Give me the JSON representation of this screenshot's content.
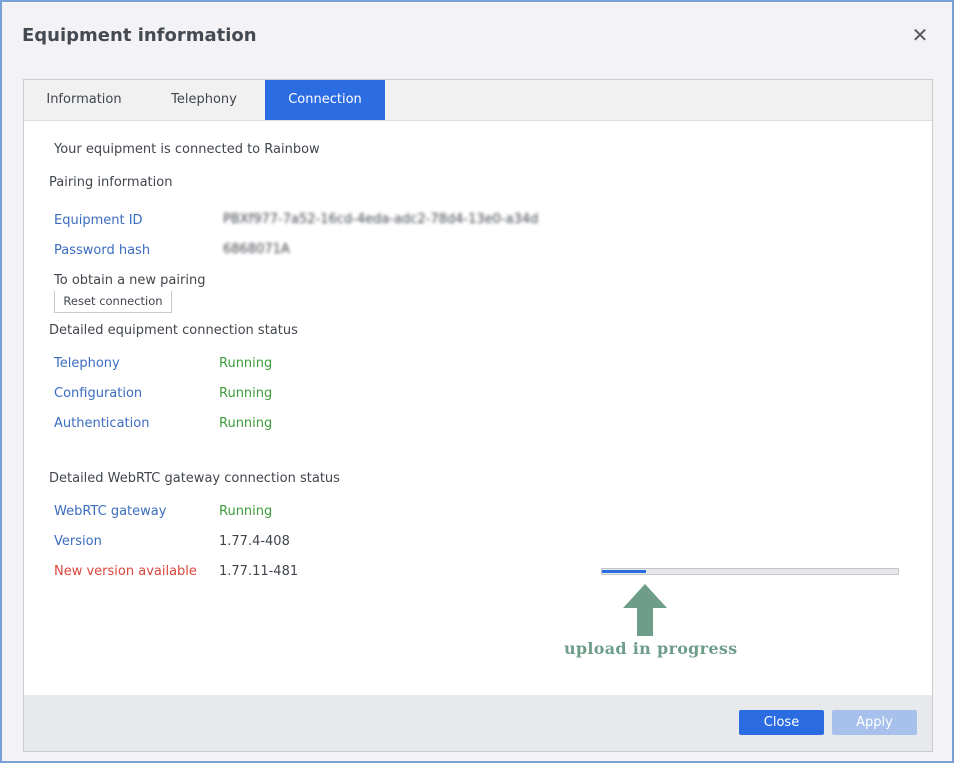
{
  "dialog": {
    "title": "Equipment information",
    "close_icon": "close-icon"
  },
  "tabs": [
    {
      "label": "Information",
      "active": false
    },
    {
      "label": "Telephony",
      "active": false
    },
    {
      "label": "Connection",
      "active": true
    }
  ],
  "connection": {
    "connected_message": "Your equipment is connected to Rainbow",
    "pairing_heading": "Pairing information",
    "equipment_id_label": "Equipment ID",
    "equipment_id_value": "PBXf977-7a52-16cd-4eda-adc2-78d4-13e0-a34d",
    "password_hash_label": "Password hash",
    "password_hash_value": "6868071A",
    "new_pairing_text": "To obtain a new pairing",
    "reset_button": "Reset connection",
    "equipment_status_heading": "Detailed equipment connection status",
    "equipment_status": [
      {
        "label": "Telephony",
        "value": "Running"
      },
      {
        "label": "Configuration",
        "value": "Running"
      },
      {
        "label": "Authentication",
        "value": "Running"
      }
    ],
    "webrtc_heading": "Detailed WebRTC gateway connection status",
    "webrtc_gateway_label": "WebRTC gateway",
    "webrtc_gateway_value": "Running",
    "version_label": "Version",
    "version_value": "1.77.4-408",
    "new_version_label": "New version available",
    "new_version_value": "1.77.11-481",
    "upload_progress_fraction": 0.15,
    "annotation": "upload in progress"
  },
  "footer": {
    "close_button": "Close",
    "apply_button": "Apply"
  },
  "colors": {
    "accent": "#2b6ce3",
    "link": "#3b6cc0",
    "running": "#3d9c3c",
    "warning": "#d9463b",
    "annotation": "#6e9e8a"
  }
}
